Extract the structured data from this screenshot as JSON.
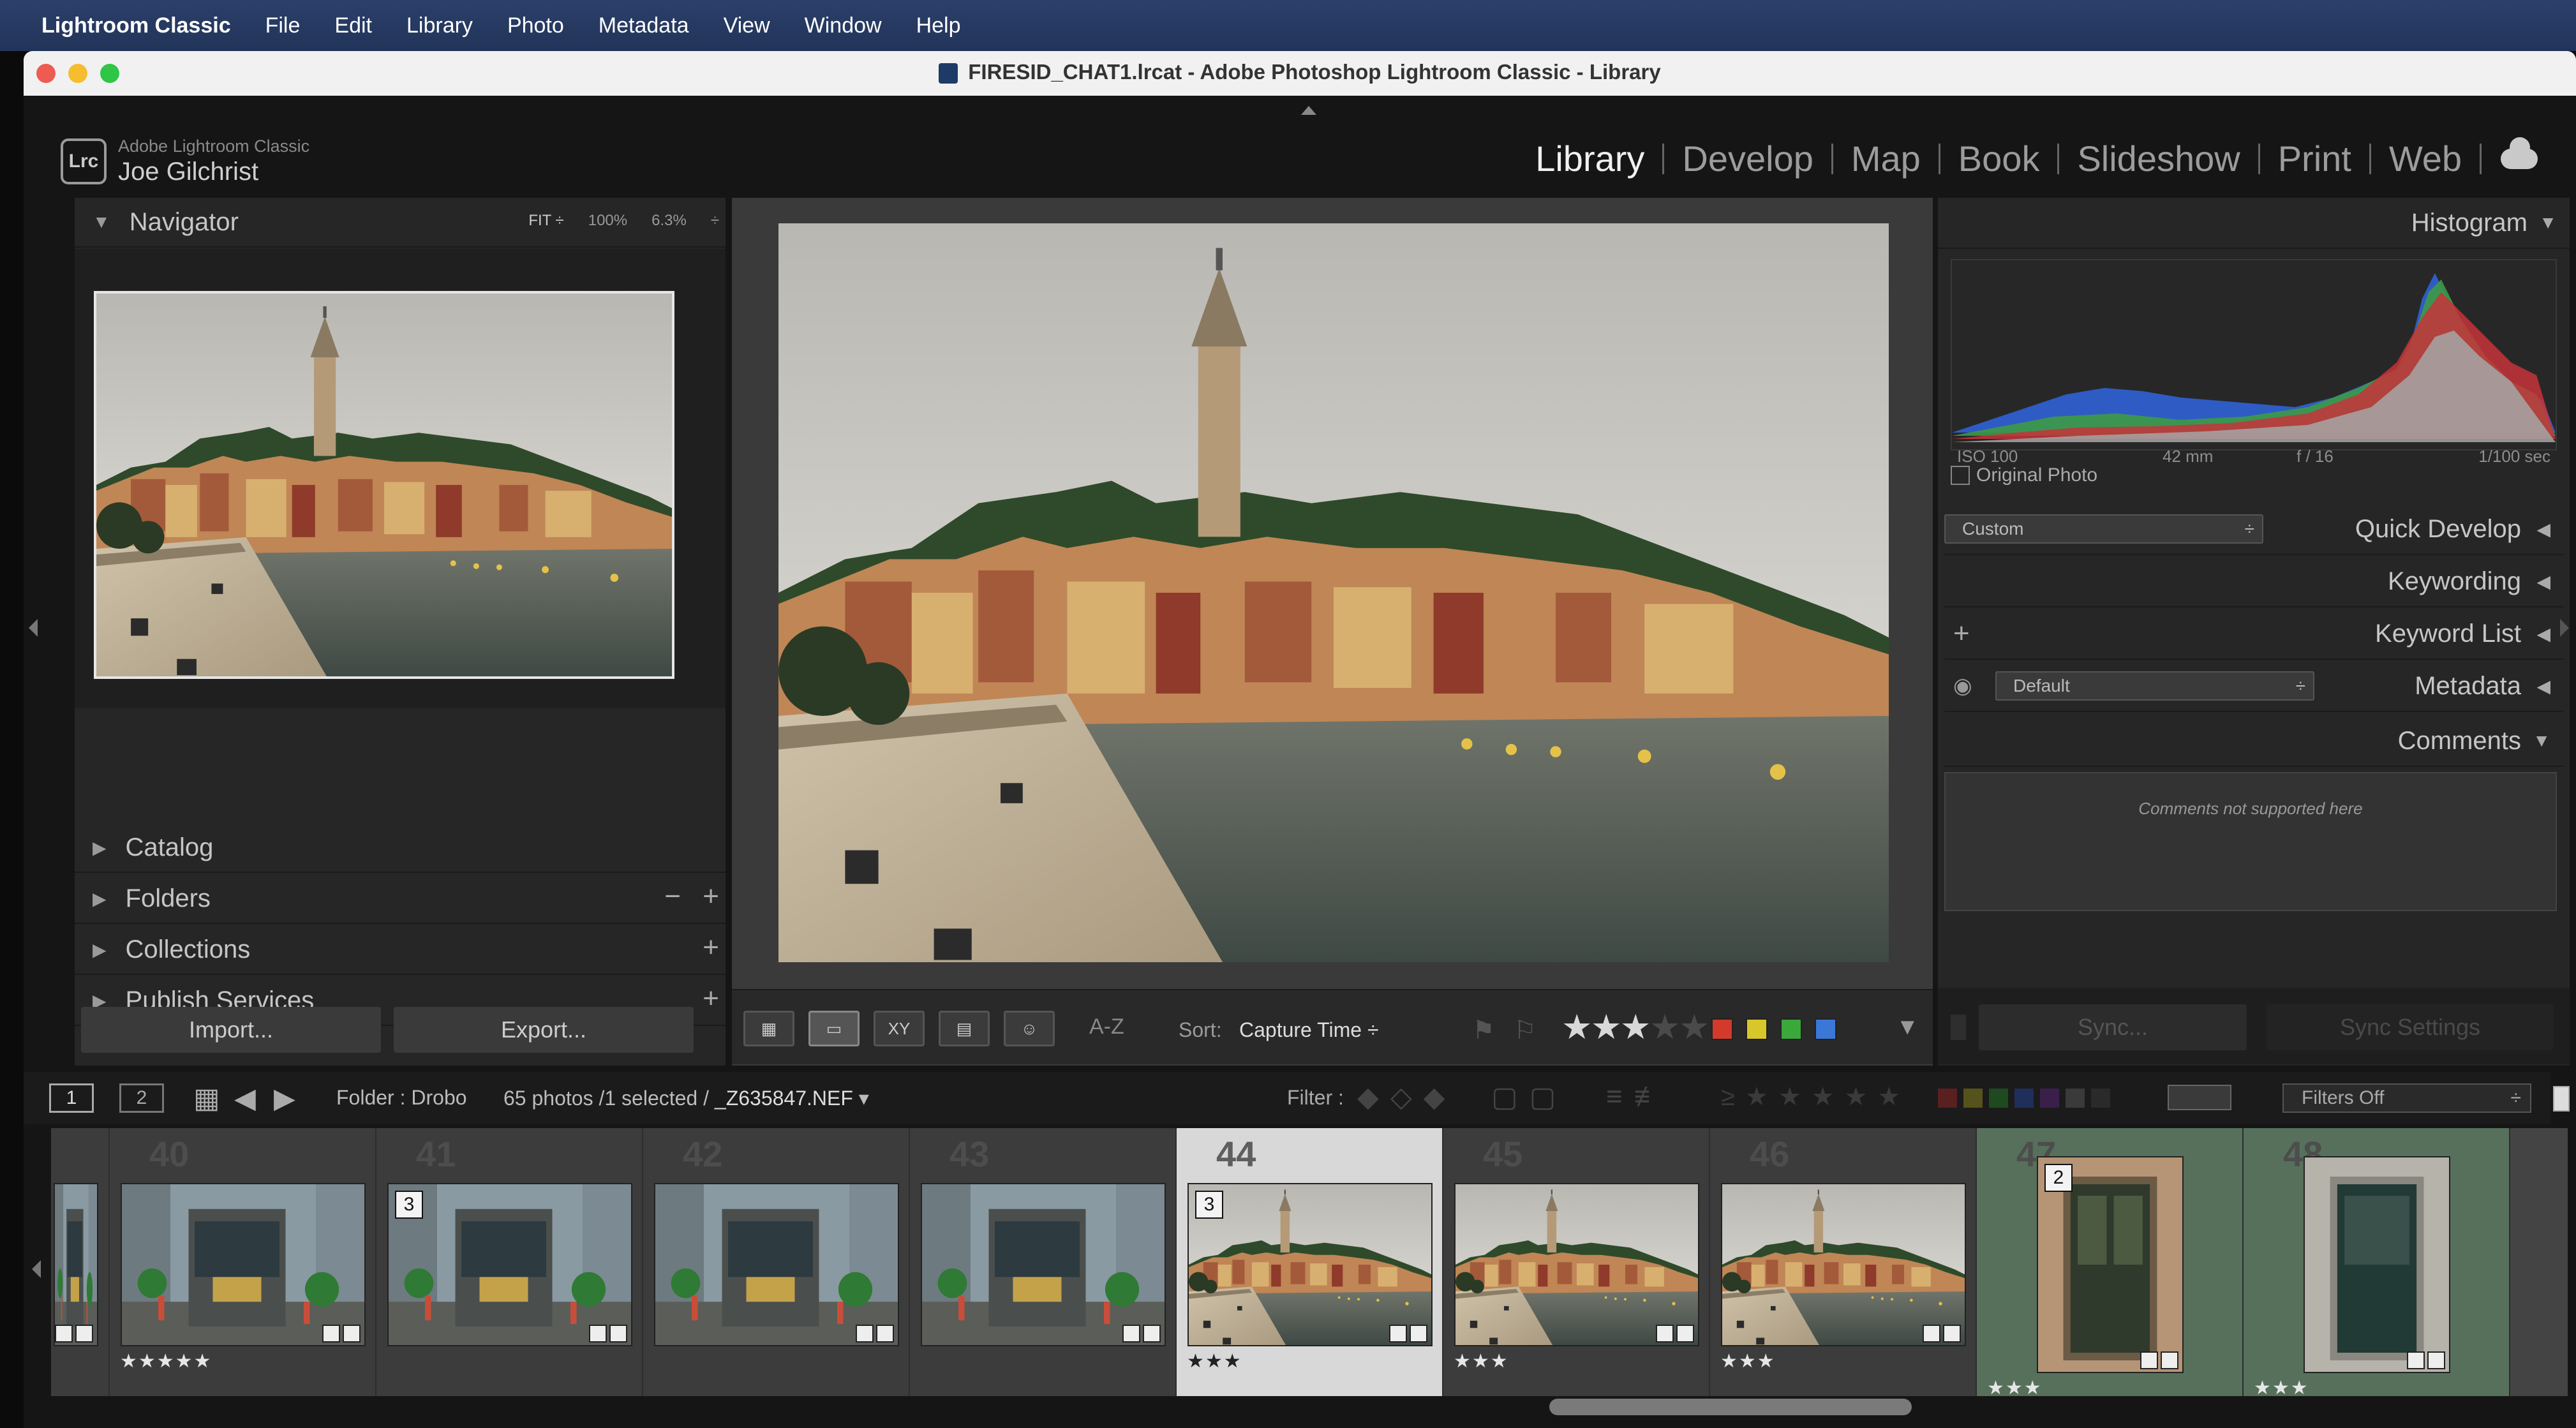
{
  "menubar": {
    "app_name": "Lightroom Classic",
    "items": [
      "File",
      "Edit",
      "Library",
      "Photo",
      "Metadata",
      "View",
      "Window",
      "Help"
    ]
  },
  "window": {
    "title": "FIRESID_CHAT1.lrcat - Adobe Photoshop Lightroom Classic - Library"
  },
  "identity_plate": {
    "logo": "Lrc",
    "product": "Adobe Lightroom Classic",
    "user": "Joe Gilchrist"
  },
  "modules": [
    "Library",
    "Develop",
    "Map",
    "Book",
    "Slideshow",
    "Print",
    "Web"
  ],
  "active_module": "Library",
  "left_panel": {
    "navigator": {
      "label": "Navigator",
      "options": [
        "FIT ÷",
        "100%",
        "6.3%",
        "÷"
      ]
    },
    "sections": [
      {
        "label": "Catalog",
        "actions": []
      },
      {
        "label": "Folders",
        "actions": [
          "−",
          "+"
        ]
      },
      {
        "label": "Collections",
        "actions": [
          "+"
        ]
      },
      {
        "label": "Publish Services",
        "actions": [
          "+"
        ]
      }
    ],
    "import_label": "Import...",
    "export_label": "Export..."
  },
  "toolbar": {
    "sort_label": "Sort:",
    "sort_value": "Capture Time",
    "sort_icon": "A-Z",
    "rating": 3,
    "rating_max": 5,
    "color_labels": [
      "#d33a2c",
      "#d8c72a",
      "#3aa83a",
      "#3a78d8"
    ]
  },
  "right_panel": {
    "histogram": {
      "label": "Histogram",
      "exif": [
        "ISO 100",
        "42 mm",
        "f / 16",
        "1/100 sec"
      ],
      "original_photo": "Original Photo"
    },
    "quick_develop": {
      "label": "Quick Develop",
      "preset": "Custom"
    },
    "keywording": {
      "label": "Keywording"
    },
    "keyword_list": {
      "label": "Keyword List",
      "add": "+"
    },
    "metadata": {
      "label": "Metadata",
      "preset": "Default"
    },
    "comments": {
      "label": "Comments",
      "message": "Comments not supported here"
    },
    "sync_label": "Sync...",
    "sync_settings_label": "Sync Settings"
  },
  "filmstrip_bar": {
    "screen1": "1",
    "screen2": "2",
    "source": "Folder : Drobo",
    "info": "65 photos /1 selected /",
    "filename": "_Z635847.NEF",
    "filter_label": "Filter :",
    "filters_off": "Filters Off"
  },
  "filmstrip": [
    {
      "number": "",
      "stars": "",
      "stack": "",
      "type": "street"
    },
    {
      "number": "40",
      "stars": "★★★★★",
      "stack": "",
      "type": "street"
    },
    {
      "number": "41",
      "stars": "",
      "stack": "3",
      "type": "street"
    },
    {
      "number": "42",
      "stars": "",
      "stack": "",
      "type": "street"
    },
    {
      "number": "43",
      "stars": "",
      "stack": "",
      "type": "street"
    },
    {
      "number": "44",
      "stars": "★★★",
      "stack": "3",
      "type": "rovinj",
      "selected": true
    },
    {
      "number": "45",
      "stars": "★★★",
      "stack": "",
      "type": "rovinj"
    },
    {
      "number": "46",
      "stars": "★★★",
      "stack": "",
      "type": "rovinj"
    },
    {
      "number": "47",
      "stars": "★★★",
      "stack": "2",
      "type": "door",
      "green": true
    },
    {
      "number": "48",
      "stars": "★★★",
      "stack": "",
      "type": "door2",
      "green": true
    }
  ]
}
